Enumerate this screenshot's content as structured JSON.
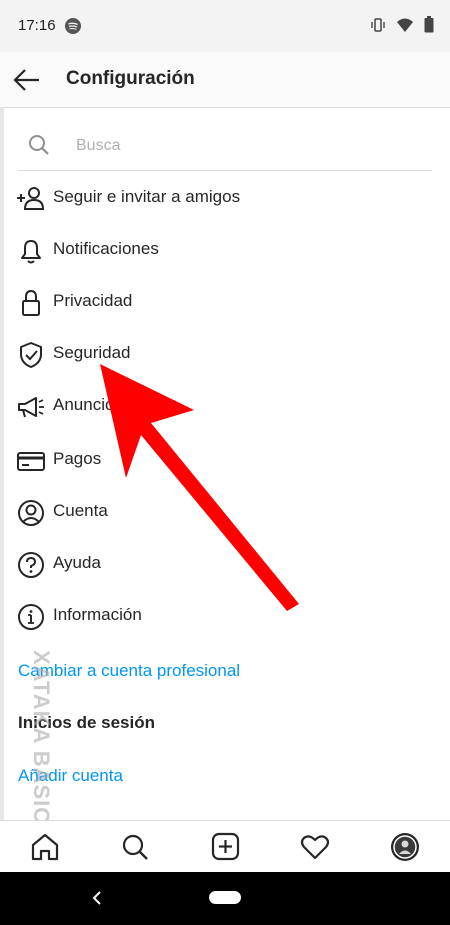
{
  "status_bar": {
    "time": "17:16"
  },
  "header": {
    "title": "Configuración"
  },
  "search": {
    "placeholder": "Busca"
  },
  "menu": {
    "items": [
      {
        "label": "Seguir e invitar a amigos",
        "icon": "add-person-icon"
      },
      {
        "label": "Notificaciones",
        "icon": "bell-icon"
      },
      {
        "label": "Privacidad",
        "icon": "lock-icon"
      },
      {
        "label": "Seguridad",
        "icon": "shield-check-icon"
      },
      {
        "label": "Anuncios",
        "icon": "megaphone-icon"
      },
      {
        "label": "Pagos",
        "icon": "credit-card-icon"
      },
      {
        "label": "Cuenta",
        "icon": "account-circle-icon"
      },
      {
        "label": "Ayuda",
        "icon": "help-circle-icon"
      },
      {
        "label": "Información",
        "icon": "info-circle-icon"
      }
    ]
  },
  "links": {
    "switch_professional": "Cambiar a cuenta profesional",
    "logins_title": "Inicios de sesión",
    "add_account": "Añadir cuenta"
  },
  "watermark": {
    "text": "XATAKA BASICS"
  },
  "colors": {
    "link": "#0095f6",
    "arrow": "#ff0000",
    "text": "#262626"
  },
  "bottom_nav": {
    "items": [
      "home-icon",
      "search-icon",
      "new-post-icon",
      "heart-icon",
      "profile-avatar"
    ]
  }
}
